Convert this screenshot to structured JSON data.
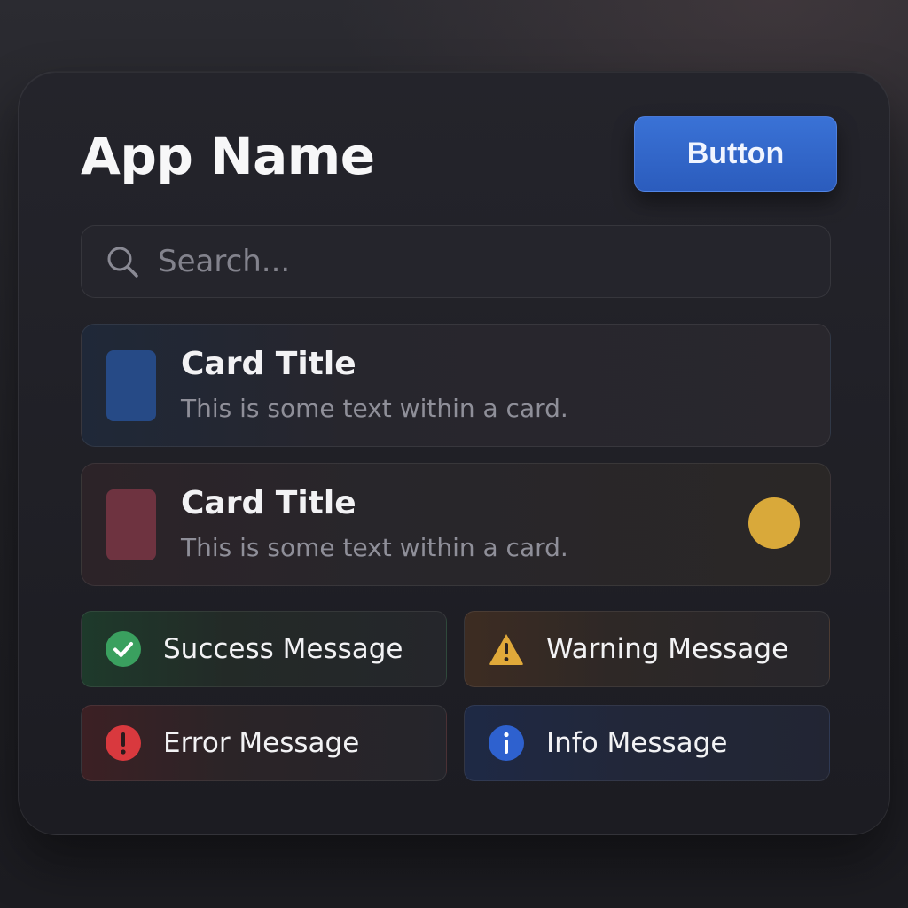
{
  "app": {
    "title": "App Name"
  },
  "header": {
    "button_label": "Button",
    "button_color": "#2f64c9"
  },
  "search": {
    "placeholder": "Search...",
    "icon": "search-icon"
  },
  "cards": [
    {
      "title": "Card Title",
      "text": "This is some text within a card.",
      "thumb_color": "#264a86"
    },
    {
      "title": "Card Title",
      "text": "This is some text within a card.",
      "thumb_color": "#6e3340",
      "indicator_color": "#d9a93a"
    }
  ],
  "alerts": {
    "success": {
      "label": "Success Message",
      "icon": "check-circle-icon",
      "color": "#3aa05f"
    },
    "warning": {
      "label": "Warning Message",
      "icon": "warning-triangle-icon",
      "color": "#e0a93a"
    },
    "error": {
      "label": "Error Message",
      "icon": "exclamation-circle-icon",
      "color": "#d9393e"
    },
    "info": {
      "label": "Info Message",
      "icon": "info-circle-icon",
      "color": "#2e61cf"
    }
  }
}
